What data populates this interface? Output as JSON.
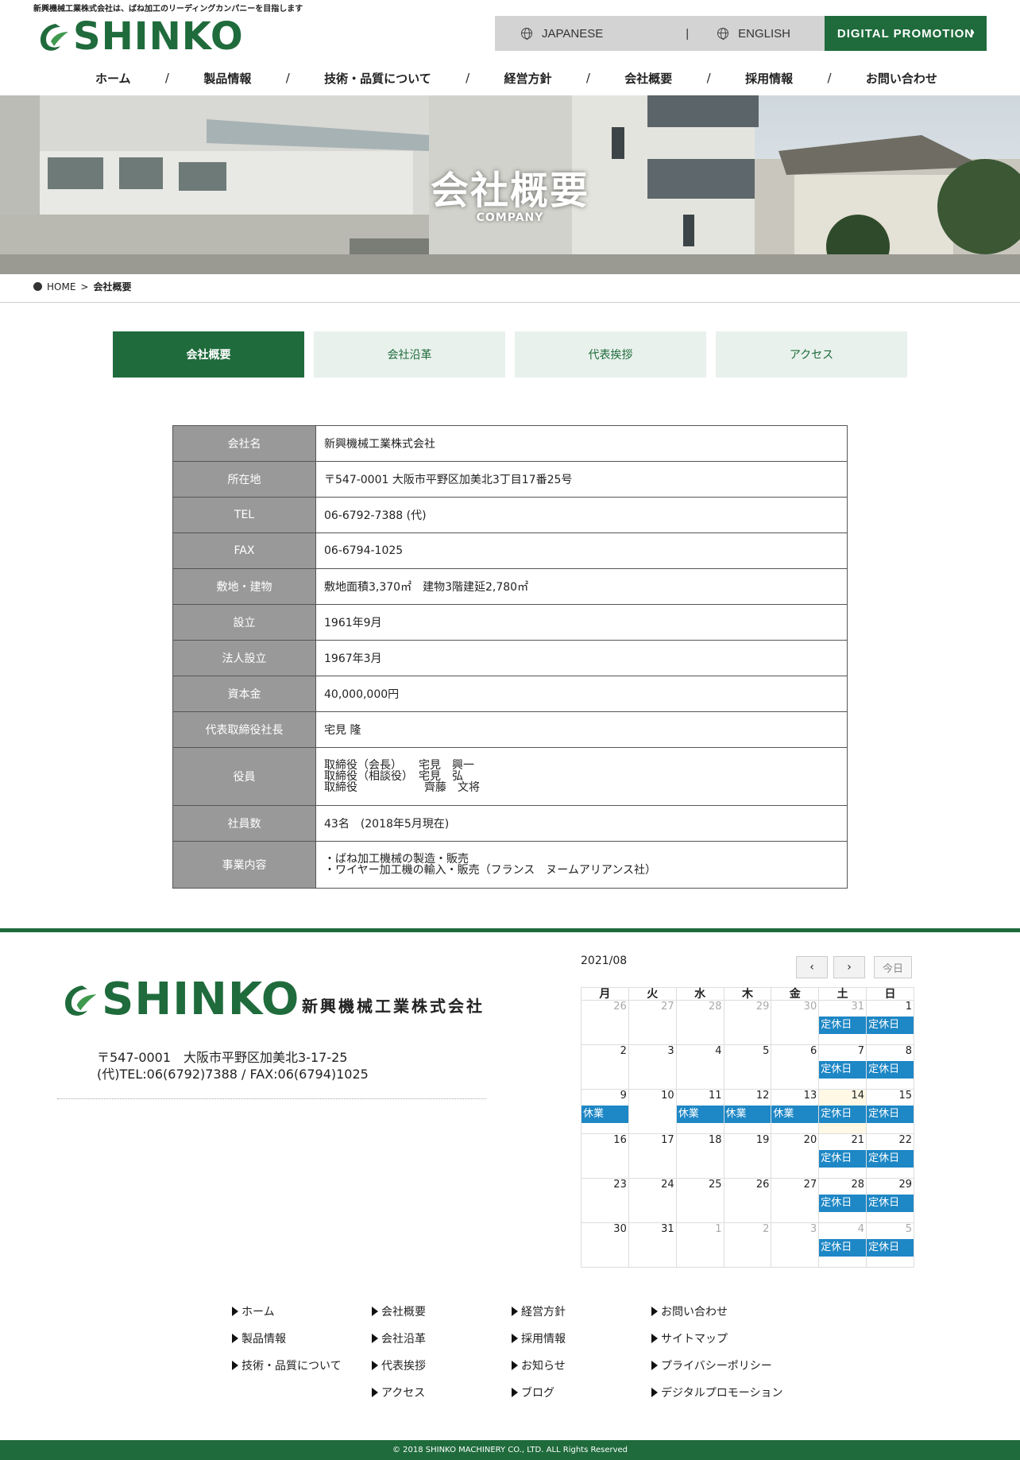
{
  "header": {
    "tagline": "新興機械工業株式会社は、ばね加工のリーディングカンパニーを目指します",
    "logo_text": "SHINKO",
    "logo_script": "Greenpeat",
    "lang_japanese": "JAPANESE",
    "lang_sep": "|",
    "lang_english": "ENGLISH",
    "digital_promotion": "DIGITAL PROMOTION",
    "chevron": "›"
  },
  "nav": {
    "items": [
      "ホーム",
      "製品情報",
      "技術・品質について",
      "経営方針",
      "会社概要",
      "採用情報",
      "お問い合わせ"
    ],
    "sep": "/"
  },
  "hero": {
    "title": "会社概要",
    "subtitle": "COMPANY"
  },
  "breadcrumb": {
    "home": "HOME",
    "sep": ">",
    "current": "会社概要"
  },
  "tabs": [
    "会社概要",
    "会社沿革",
    "代表挨拶",
    "アクセス"
  ],
  "company_table": [
    {
      "key": "会社名",
      "value": "新興機械工業株式会社"
    },
    {
      "key": "所在地",
      "value": "〒547-0001 大阪市平野区加美北3丁目17番25号"
    },
    {
      "key": "TEL",
      "value": "06-6792-7388 (代)"
    },
    {
      "key": "FAX",
      "value": "06-6794-1025"
    },
    {
      "key": "敷地・建物",
      "value": "敷地面積3,370㎡　建物3階建延2,780㎡"
    },
    {
      "key": "設立",
      "value": "1961年9月"
    },
    {
      "key": "法人設立",
      "value": "1967年3月"
    },
    {
      "key": "資本金",
      "value": "40,000,000円"
    },
    {
      "key": "代表取締役社長",
      "value": "宅見 隆"
    },
    {
      "key": "役員",
      "lines": [
        "取締役（会長）　　宅見　興一",
        "取締役（相談役）　宅見　弘",
        "取締役　　　　　　齊藤　文将"
      ]
    },
    {
      "key": "社員数",
      "value": "43名　(2018年5月現在)"
    },
    {
      "key": "事業内容",
      "lines": [
        "・ばね加工機械の製造・販売",
        "・ワイヤー加工機の輸入・販売（フランス　ヌームアリアンス社）"
      ]
    }
  ],
  "footer": {
    "logo_text": "SHINKO",
    "logo_script": "Greenpeat",
    "company_name": "新興機械工業株式会社",
    "address_line1": "〒547-0001　大阪市平野区加美北3-17-25",
    "address_line2": "(代)TEL:06(6792)7388 / FAX:06(6794)1025",
    "links": [
      "ホーム",
      "会社概要",
      "経営方針",
      "お問い合わせ",
      "製品情報",
      "会社沿革",
      "採用情報",
      "サイトマップ",
      "技術・品質について",
      "代表挨拶",
      "お知らせ",
      "プライバシーポリシー",
      "",
      "アクセス",
      "ブログ",
      "デジタルプロモーション"
    ],
    "copyright": "© 2018 SHINKO MACHINERY CO., LTD. ALL Rights Reserved"
  },
  "calendar": {
    "month_label": "2021/08",
    "prev": "‹",
    "next": "›",
    "today": "今日",
    "weekdays": [
      "月",
      "火",
      "水",
      "木",
      "金",
      "土",
      "日"
    ],
    "weeks": [
      [
        {
          "d": "26",
          "o": true
        },
        {
          "d": "27",
          "o": true
        },
        {
          "d": "28",
          "o": true
        },
        {
          "d": "29",
          "o": true
        },
        {
          "d": "30",
          "o": true
        },
        {
          "d": "31",
          "o": true,
          "ev": "定休日"
        },
        {
          "d": "1",
          "ev": "定休日"
        }
      ],
      [
        {
          "d": "2"
        },
        {
          "d": "3"
        },
        {
          "d": "4"
        },
        {
          "d": "5"
        },
        {
          "d": "6"
        },
        {
          "d": "7",
          "ev": "定休日"
        },
        {
          "d": "8",
          "ev": "定休日"
        }
      ],
      [
        {
          "d": "9",
          "ev": "休業"
        },
        {
          "d": "10"
        },
        {
          "d": "11",
          "ev": "休業"
        },
        {
          "d": "12",
          "ev": "休業"
        },
        {
          "d": "13",
          "ev": "休業"
        },
        {
          "d": "14",
          "ev": "定休日",
          "hl": true
        },
        {
          "d": "15",
          "ev": "定休日"
        }
      ],
      [
        {
          "d": "16"
        },
        {
          "d": "17"
        },
        {
          "d": "18"
        },
        {
          "d": "19"
        },
        {
          "d": "20"
        },
        {
          "d": "21",
          "ev": "定休日"
        },
        {
          "d": "22",
          "ev": "定休日"
        }
      ],
      [
        {
          "d": "23"
        },
        {
          "d": "24"
        },
        {
          "d": "25"
        },
        {
          "d": "26"
        },
        {
          "d": "27"
        },
        {
          "d": "28",
          "ev": "定休日"
        },
        {
          "d": "29",
          "ev": "定休日"
        }
      ],
      [
        {
          "d": "30"
        },
        {
          "d": "31"
        },
        {
          "d": "1",
          "o": true
        },
        {
          "d": "2",
          "o": true
        },
        {
          "d": "3",
          "o": true
        },
        {
          "d": "4",
          "o": true,
          "ev": "定休日"
        },
        {
          "d": "5",
          "o": true,
          "ev": "定休日"
        }
      ]
    ]
  },
  "colors": {
    "brand_green": "#1f6b3c",
    "tab_light": "#e8f1ec",
    "event_blue": "#1e87c5",
    "table_key_bg": "#999999",
    "highlight_day": "#fff8e5"
  }
}
